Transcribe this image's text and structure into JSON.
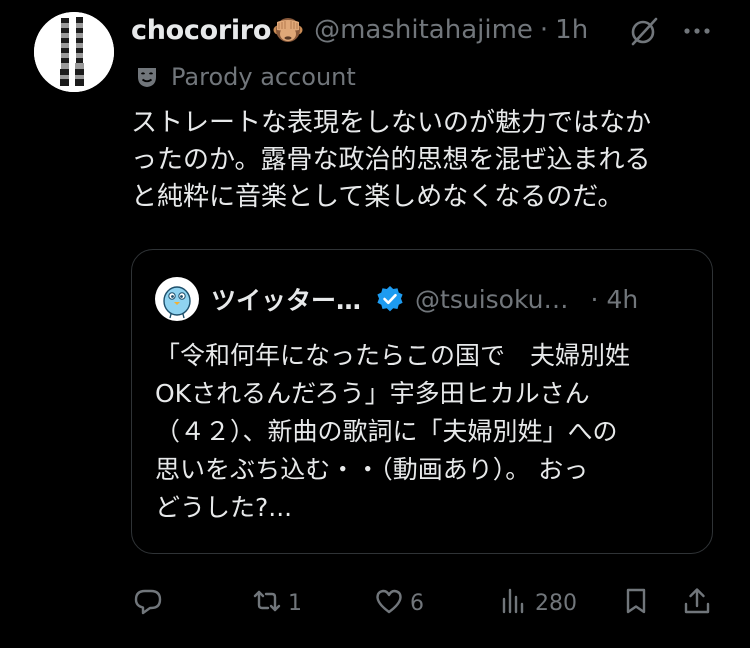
{
  "post": {
    "display_name": "chocoriro",
    "name_emoji": "see-no-evil-monkey-icon",
    "handle": "@mashitahajime",
    "separator": "·",
    "time": "1h",
    "label": "Parody account",
    "text": "ストレートな表現をしないのが魅力ではなか\nったのか。露骨な政治的思想を混ぜ込まれる\nと純粋に音楽として楽しめなくなるのだ。"
  },
  "quote": {
    "display_name": "ツイッター…",
    "handle": "@tsuisoku…",
    "separator": "·",
    "time": "4h",
    "text": "「令和何年になったらこの国で　夫婦別姓\nOKされるんだろう」宇多田ヒカルさん\n（４２）、新曲の歌詞に「夫婦別姓」への\n思いをぶち込む・・（動画あり）。 おっ\nどうした?..."
  },
  "actions": {
    "reply_count": "",
    "repost_count": "1",
    "like_count": "6",
    "views_count": "280"
  },
  "colors": {
    "background": "#000000",
    "text": "#e7e9ea",
    "secondary": "#71767b",
    "border": "#2f3336",
    "verified": "#1d9bf0"
  }
}
